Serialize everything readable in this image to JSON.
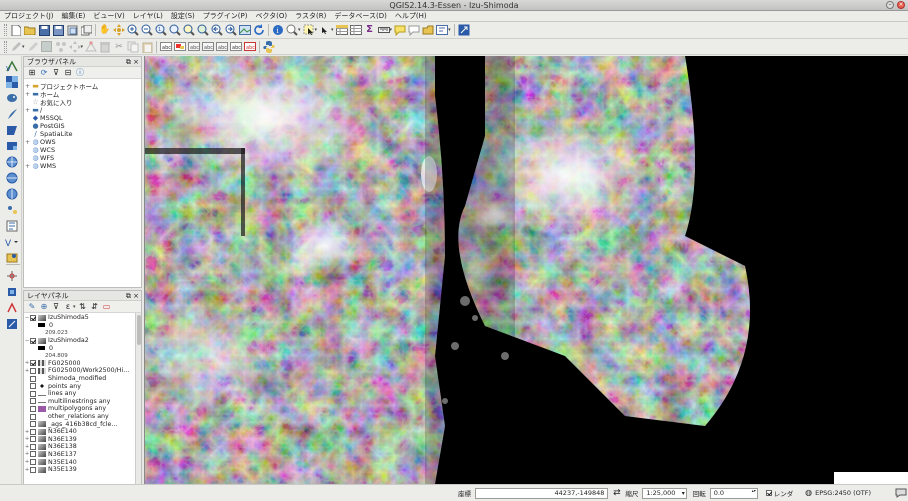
{
  "window": {
    "title": "QGIS2.14.3-Essen - Izu-Shimoda"
  },
  "menubar": [
    "プロジェクト(J)",
    "編集(E)",
    "ビュー(V)",
    "レイヤ(L)",
    "設定(S)",
    "プラグイン(P)",
    "ベクタ(O)",
    "ラスタ(R)",
    "データベース(D)",
    "ヘルプ(H)"
  ],
  "toolbar1_icons": [
    "new-project-icon",
    "open-project-icon",
    "save-project-icon",
    "save-as-icon",
    "print-composer-icon",
    "composer-manager-icon",
    "pan-icon",
    "pan-to-selection-icon",
    "zoom-in-icon",
    "zoom-out-icon",
    "zoom-native-icon",
    "zoom-full-icon",
    "zoom-to-selection-icon",
    "zoom-to-layer-icon",
    "zoom-last-icon",
    "zoom-next-icon",
    "new-map-view-icon",
    "refresh-icon",
    "identify-icon",
    "measure-icon",
    "select-icon",
    "deselect-icon",
    "attribute-table-icon",
    "statistics-icon",
    "sum-icon",
    "measure-line-icon",
    "annotation-icon",
    "label-icon",
    "pin-icon",
    "tips-icon",
    "whats-this-icon"
  ],
  "toolbar2_icons": [
    "current-edits-icon",
    "toggle-editing-icon",
    "save-edits-icon",
    "add-feature-icon",
    "move-feature-icon",
    "node-tool-icon",
    "delete-selected-icon",
    "cut-features-icon",
    "copy-features-icon",
    "paste-features-icon",
    "label-pin-icon",
    "label-highlight-icon",
    "label-move-icon",
    "label-rotate-icon",
    "label-change-icon",
    "label-show-icon",
    "label-hide-icon",
    "python-console-icon"
  ],
  "browser_panel": {
    "title": "ブラウザパネル",
    "items": [
      {
        "label": "プロジェクトホーム",
        "icon": "folder-icon",
        "expand": "+"
      },
      {
        "label": "ホーム",
        "icon": "home-folder-icon",
        "expand": "+"
      },
      {
        "label": "お気に入り",
        "icon": "favorites-star-icon",
        "expand": ""
      },
      {
        "label": "/",
        "icon": "root-folder-icon",
        "expand": "+"
      },
      {
        "label": "MSSQL",
        "icon": "mssql-icon",
        "expand": ""
      },
      {
        "label": "PostGIS",
        "icon": "postgis-elephant-icon",
        "expand": ""
      },
      {
        "label": "SpatiaLite",
        "icon": "spatialite-feather-icon",
        "expand": ""
      },
      {
        "label": "OWS",
        "icon": "ows-globe-icon",
        "expand": "+"
      },
      {
        "label": "WCS",
        "icon": "wcs-globe-icon",
        "expand": ""
      },
      {
        "label": "WFS",
        "icon": "wfs-globe-icon",
        "expand": ""
      },
      {
        "label": "WMS",
        "icon": "wms-globe-icon",
        "expand": "+"
      }
    ]
  },
  "layers_panel": {
    "title": "レイヤパネル",
    "layers": [
      {
        "name": "IzuShimoda5",
        "checked": true,
        "kind": "raster",
        "expand": "−",
        "legend": [
          "0",
          "209.023"
        ]
      },
      {
        "name": "IzuShimoda2",
        "checked": true,
        "kind": "raster",
        "expand": "−",
        "legend": [
          "0",
          "204.809"
        ]
      },
      {
        "name": "FG025000",
        "checked": true,
        "kind": "grid",
        "expand": "+"
      },
      {
        "name": "FG025000/Work2500/Hi...",
        "checked": false,
        "kind": "grid",
        "expand": "+"
      },
      {
        "name": "Shimoda_modified",
        "checked": false,
        "kind": "none",
        "expand": ""
      },
      {
        "name": "points any",
        "checked": false,
        "kind": "point",
        "expand": ""
      },
      {
        "name": "lines any",
        "checked": false,
        "kind": "line",
        "expand": ""
      },
      {
        "name": "multilinestrings any",
        "checked": false,
        "kind": "line",
        "expand": ""
      },
      {
        "name": "multipolygons any",
        "checked": false,
        "kind": "vec",
        "expand": ""
      },
      {
        "name": "other_relations any",
        "checked": false,
        "kind": "none",
        "expand": ""
      },
      {
        "name": "_ags_416b38cd_fcle...",
        "checked": false,
        "kind": "raster",
        "expand": ""
      },
      {
        "name": "N36E140",
        "checked": false,
        "kind": "raster",
        "expand": "+"
      },
      {
        "name": "N36E139",
        "checked": false,
        "kind": "raster",
        "expand": "+"
      },
      {
        "name": "N36E138",
        "checked": false,
        "kind": "raster",
        "expand": "+"
      },
      {
        "name": "N36E137",
        "checked": false,
        "kind": "raster",
        "expand": "+"
      },
      {
        "name": "N35E140",
        "checked": false,
        "kind": "raster",
        "expand": "+"
      },
      {
        "name": "N35E139",
        "checked": false,
        "kind": "raster",
        "expand": "+"
      }
    ]
  },
  "statusbar": {
    "coord_label": "座標",
    "coord_value": "44237,-149848",
    "scale_label": "縮尺",
    "scale_value": "1:25,000",
    "rotation_label": "回転",
    "rotation_value": "0.0",
    "render_label": "レンダ",
    "crs": "EPSG:2450 (OTF)"
  }
}
